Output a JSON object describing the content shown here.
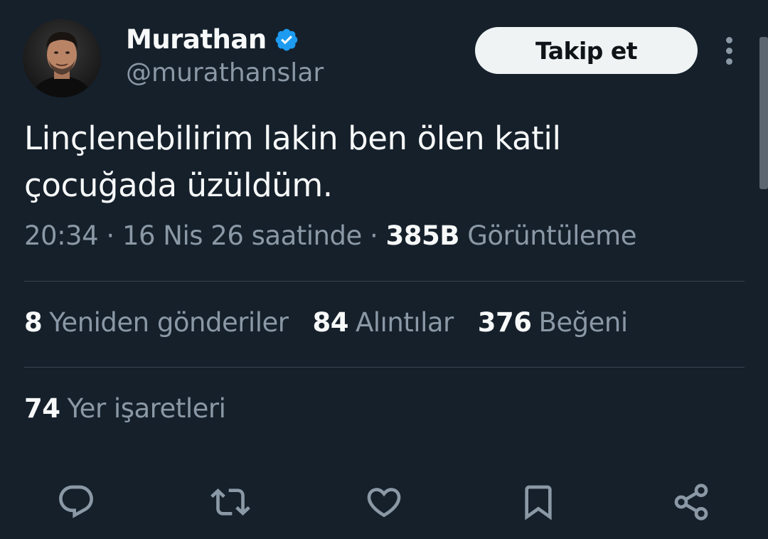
{
  "author": {
    "display_name": "Murathan",
    "handle": "@murathanslar",
    "verified_icon": "verified-badge-icon"
  },
  "header": {
    "follow_label": "Takip et"
  },
  "tweet": {
    "text_line_1": "Linçlenebilirim lakin ben ölen katil",
    "text_line_2": "çocuğada üzüldüm.",
    "time": "20:34",
    "sep1": " · ",
    "date": "16 Nis 26 saatinde",
    "sep2": " · ",
    "views_count": "385B",
    "views_label": "Görüntüleme"
  },
  "stats": {
    "retweets_count": "8",
    "retweets_label": "Yeniden gönderiler",
    "quotes_count": "84",
    "quotes_label": "Alıntılar",
    "likes_count": "376",
    "likes_label": "Beğeni",
    "bookmarks_count": "74",
    "bookmarks_label": "Yer işaretleri"
  },
  "actions": [
    "reply-icon",
    "retweet-icon",
    "like-icon",
    "bookmark-icon",
    "share-icon"
  ],
  "colors": {
    "background": "#15202b",
    "text": "#f7f9f9",
    "secondary": "#8b98a5",
    "divider": "#38444d",
    "verified": "#1d9bf0",
    "button_bg": "#eff3f4"
  }
}
